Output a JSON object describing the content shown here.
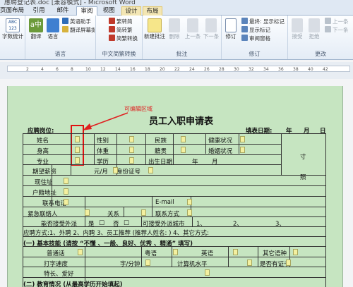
{
  "window": {
    "title": "應聘登记表.doc [兼容模式] - Microsoft Word"
  },
  "tabs": [
    {
      "label": "页面布局",
      "active": false
    },
    {
      "label": "引用",
      "active": false
    },
    {
      "label": "邮件",
      "active": false
    },
    {
      "label": "审阅",
      "active": true
    },
    {
      "label": "视图",
      "active": false
    },
    {
      "label": "设计",
      "active": false
    },
    {
      "label": "布局",
      "active": false
    }
  ],
  "ribbon": {
    "proofing": {
      "label": "",
      "word_count": "字数统计"
    },
    "language": {
      "label": "语言",
      "translate": "翻译",
      "language": "语言",
      "english_assistant": "英语助手",
      "translate_screen_tip": "翻译屏幕提示"
    },
    "chinese": {
      "label": "中文简繁转换",
      "to_simplified": "繁转简",
      "to_traditional": "简转繁",
      "convert": "简繁转换"
    },
    "comments": {
      "label": "批注",
      "new": "新建批注",
      "delete": "删除",
      "previous": "上一条",
      "next": "下一条"
    },
    "tracking": {
      "label": "修订",
      "track_changes": "修订",
      "final": "最终: 显示标记",
      "show_markup": "显示标记",
      "reviewing_pane": "审阅窗格"
    },
    "changes": {
      "label": "更改",
      "accept": "接受",
      "reject": "拒绝",
      "previous": "上一条",
      "next": "下一条"
    }
  },
  "ruler": {
    "ticks": [
      "2",
      "4",
      "6",
      "8",
      "10",
      "12",
      "14",
      "16",
      "18",
      "20",
      "22",
      "24",
      "26",
      "28",
      "30",
      "32",
      "34",
      "36",
      "38",
      "40",
      "42"
    ]
  },
  "annotation": {
    "text": "可编辑区域"
  },
  "document": {
    "title": "员工入职申请表",
    "position_label": "应聘岗位:",
    "date_label": "填表日期:",
    "year": "年",
    "month": "月",
    "day": "日",
    "fields": {
      "name": "姓名",
      "gender": "性别",
      "ethnicity": "民族",
      "health": "健康状况",
      "height": "身高",
      "weight": "体重",
      "origin": "籍贯",
      "marital": "婚姻状况",
      "major": "专业",
      "education": "学历",
      "birthdate": "出生日期",
      "year_short": "年",
      "month_short": "月",
      "photo_1": "寸",
      "photo_2": "照",
      "salary": "期望薪资",
      "salary_unit": "元/月",
      "id_number": "身份证号",
      "address": "现住址",
      "hukou": "户籍地址",
      "phone": "联系电话",
      "email": "E-mail",
      "emergency": "紧急联络人",
      "relation": "关系",
      "contact": "联系方式",
      "relocate": "能否接受外派",
      "yes": "是",
      "no": "否",
      "city": "可接受外派城市",
      "opt_1": "1、",
      "opt_2": "2、",
      "opt_3": "3、",
      "source": "应聘方式:1、外聘   2、内聘   3、员工推荐 (推荐人姓名:    ) 4、其它方式:",
      "skills_header": "(一) 基本技能 (请按 “不懂 、一般、良好、优秀 、精通” 填写)",
      "mandarin": "普通话",
      "cantonese": "粤语",
      "english": "英语",
      "other_lang": "其它语种",
      "typing": "打字速度",
      "typing_unit": "字/分钟",
      "computer": "计算机水平",
      "cert": "是否有证书",
      "hobbies": "特长、爱好",
      "education_header": "(二) 教育情况 (从最高学历开始填起)"
    }
  }
}
